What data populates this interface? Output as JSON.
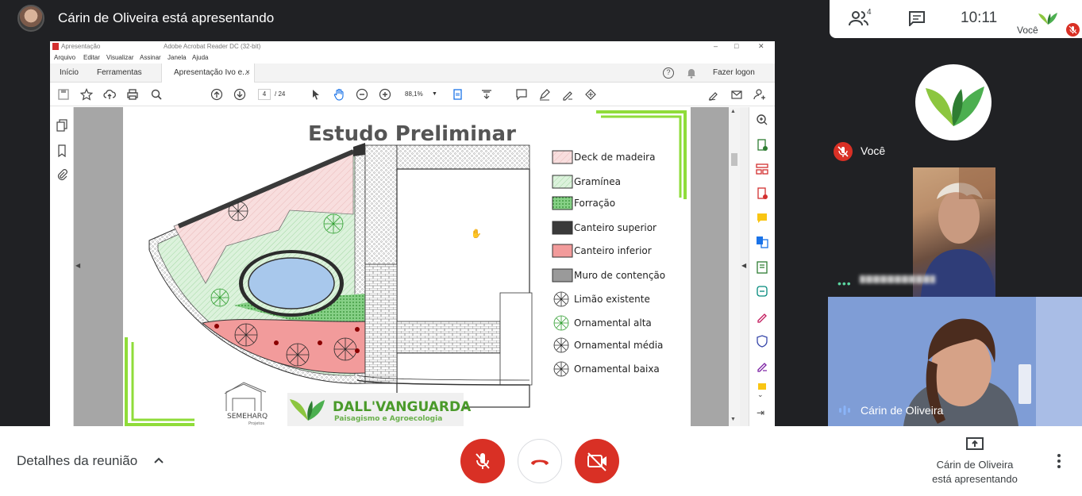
{
  "presenter_bar": {
    "title": "Cárin de Oliveira está apresentando"
  },
  "info_bar": {
    "people_count": "4",
    "clock": "10:11",
    "self_label": "Você"
  },
  "acrobat": {
    "title_left": "Apresentação",
    "title_center": "Adobe Acrobat Reader DC (32-bit)",
    "window_controls": [
      "–",
      "□",
      "✕"
    ],
    "menu": [
      "Arquivo",
      "Editar",
      "Visualizar",
      "Assinar",
      "Janela",
      "Ajuda"
    ],
    "tabs": {
      "home": "Início",
      "tools": "Ferramentas",
      "document": "Apresentação Ivo e...",
      "close": "×",
      "login": "Fazer logon"
    },
    "toolbar": {
      "page_current": "4",
      "page_total": "/ 24",
      "zoom": "88,1%"
    }
  },
  "slide": {
    "title": "Estudo Preliminar",
    "legend": [
      {
        "label": "Deck de madeira",
        "swatch": "#f6dada",
        "kind": "hatch"
      },
      {
        "label": "Gramínea",
        "swatch": "#d6f0d6",
        "kind": "hatch"
      },
      {
        "label": "Forração",
        "swatch": "#7ccf7c",
        "kind": "dots"
      },
      {
        "label": "Canteiro superior",
        "swatch": "#3a3a3a",
        "kind": "fill"
      },
      {
        "label": "Canteiro inferior",
        "swatch": "#f29b9b",
        "kind": "fill"
      },
      {
        "label": "Muro de contenção",
        "swatch": "#9a9a9a",
        "kind": "fill"
      },
      {
        "label": "Limão existente",
        "kind": "tree-dark"
      },
      {
        "label": "Ornamental alta",
        "kind": "tree-green"
      },
      {
        "label": "Ornamental média",
        "kind": "tree-dark"
      },
      {
        "label": "Ornamental baixa",
        "kind": "tree-dark"
      }
    ],
    "logo_left_name": "SEMEHARQ",
    "logo_left_sub": "Projetos",
    "logo_right_name": "DALL'VANGUARDA",
    "logo_right_sub": "Paisagismo e Agroecologia",
    "accent_green": "#8fdc3a"
  },
  "participants": {
    "self_name": "Você",
    "participant_3_name": "Cárin de Oliveira"
  },
  "bottom_bar": {
    "details": "Detalhes da reunião",
    "present_line1": "Cárin de Oliveira",
    "present_line2": "está apresentando"
  },
  "colors": {
    "danger": "#d93025",
    "background": "#202124",
    "text": "#3c4043"
  }
}
